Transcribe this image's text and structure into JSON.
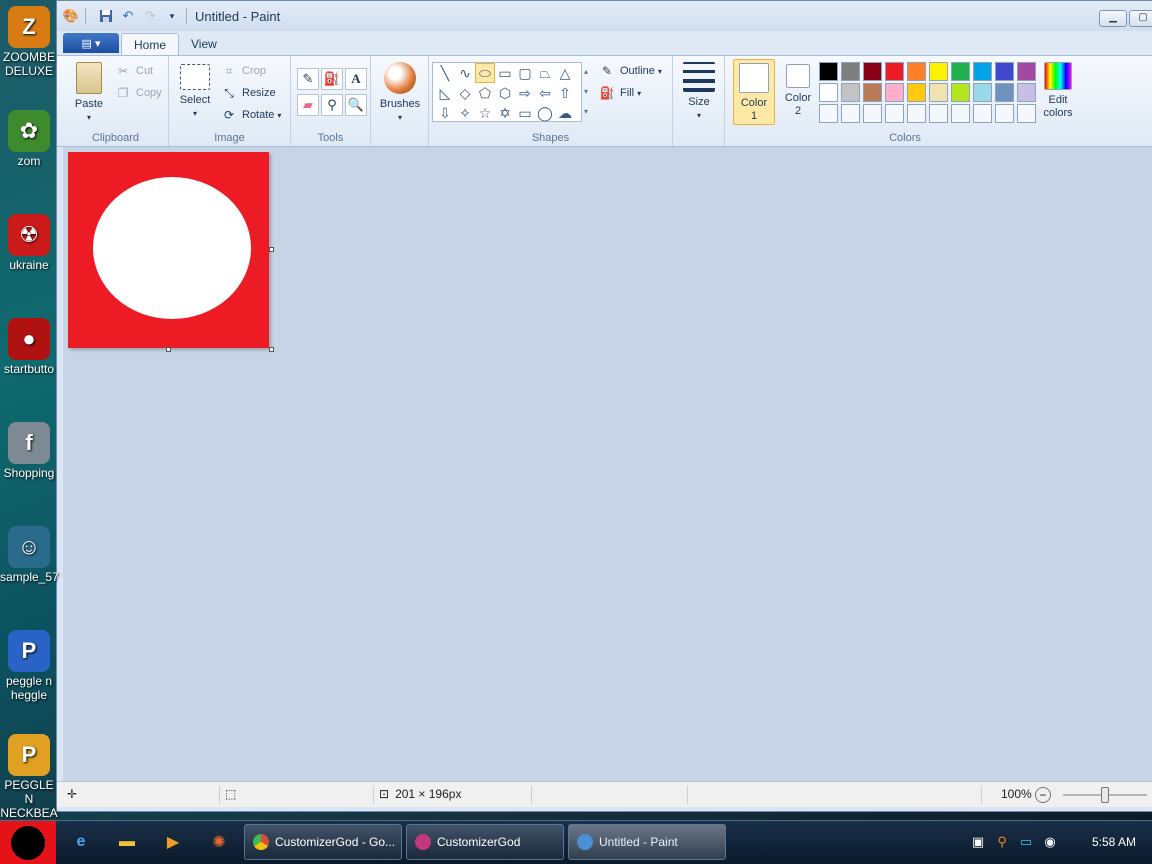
{
  "desktop": {
    "icons": [
      {
        "label": "ZOOMBE DELUXE",
        "name": "desktop-icon-zoombe",
        "glyph": "Z",
        "color": "#d77b12"
      },
      {
        "label": "zom",
        "name": "desktop-icon-zom",
        "glyph": "✿",
        "color": "#3e8b2e"
      },
      {
        "label": "ukraine",
        "name": "desktop-icon-ukraine",
        "glyph": "☢",
        "color": "#cc1b1b"
      },
      {
        "label": "startbutto",
        "name": "desktop-icon-startbutton",
        "glyph": "●",
        "color": "#b01212"
      },
      {
        "label": "Shopping",
        "name": "desktop-icon-shopping",
        "glyph": "f",
        "color": "#7e8a93"
      },
      {
        "label": "sample_57",
        "name": "desktop-icon-sample",
        "glyph": "☺",
        "color": "#2a6a8a"
      },
      {
        "label": "peggle n heggle",
        "name": "desktop-icon-peggle",
        "glyph": "P",
        "color": "#2a63c6"
      },
      {
        "label": "PEGGLE N NECKBEA",
        "name": "desktop-icon-peggle-neckbeard",
        "glyph": "P",
        "color": "#e0a021"
      }
    ]
  },
  "window": {
    "title": "Untitled - Paint",
    "tabs": [
      "Home",
      "View"
    ],
    "active_tab": "Home"
  },
  "ribbon": {
    "clipboard": {
      "label": "Clipboard",
      "paste": "Paste",
      "cut": "Cut",
      "copy": "Copy"
    },
    "image": {
      "label": "Image",
      "select": "Select",
      "crop": "Crop",
      "resize": "Resize",
      "rotate": "Rotate"
    },
    "tools": {
      "label": "Tools"
    },
    "brushes": {
      "label": "Brushes"
    },
    "shapes": {
      "label": "Shapes",
      "outline": "Outline",
      "fill": "Fill",
      "selected": "oval"
    },
    "size": {
      "label": "Size"
    },
    "colors": {
      "label": "Colors",
      "color1": "Color 1",
      "color2": "Color 2",
      "color1_value": "#ffffff",
      "color2_value": "#ffffff",
      "edit": "Edit colors",
      "palette_row1": [
        "#000000",
        "#7f7f7f",
        "#880015",
        "#ed1c24",
        "#ff7f27",
        "#fff200",
        "#22b14c",
        "#00a2e8",
        "#3f48cc",
        "#a349a4"
      ],
      "palette_row2": [
        "#ffffff",
        "#c3c3c3",
        "#b97a57",
        "#ffaec9",
        "#ffc90e",
        "#efe4b0",
        "#b5e61d",
        "#99d9ea",
        "#7092be",
        "#c8bfe7"
      ]
    }
  },
  "canvas": {
    "background": "#ed1c24",
    "ellipse_fill": "#ffffff"
  },
  "status": {
    "dimensions": "201 × 196px",
    "zoom": "100%"
  },
  "taskbar": {
    "buttons": [
      {
        "label": "CustomizerGod - Go...",
        "name": "taskbar-chrome",
        "color": "#dd4b39"
      },
      {
        "label": "CustomizerGod",
        "name": "taskbar-customizergod",
        "color": "#c0397e"
      },
      {
        "label": "Untitled - Paint",
        "name": "taskbar-paint",
        "color": "#4b8fd6"
      }
    ],
    "clock": "5:58 AM"
  }
}
